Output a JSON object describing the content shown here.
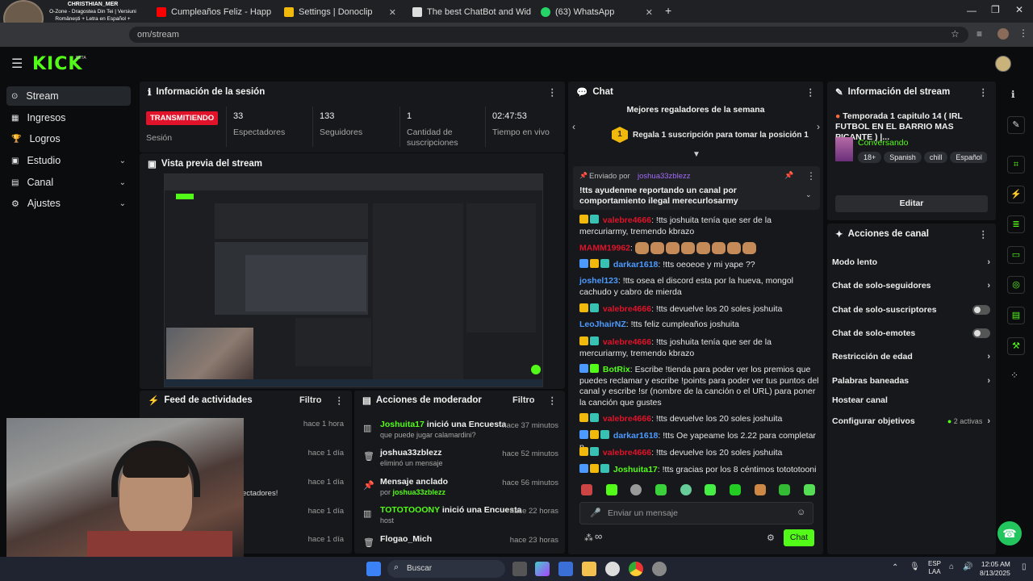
{
  "browser": {
    "tabs": [
      {
        "label": "CHRISTHIAN_MER",
        "sublabel": "O-Zone - Dragostea Din Tei | Versiuni Românești + Letra en Español + Video Oficial",
        "color": "#6b5b4b"
      },
      {
        "label": "Cumpleaños Feliz - Happy Birth",
        "color": "#ff0000"
      },
      {
        "label": "Settings | Donoclip",
        "color": "#f0b90b"
      },
      {
        "label": "The best ChatBot and Widg",
        "color": "#ffffff"
      },
      {
        "label": "(63) WhatsApp",
        "color": "#25d366"
      }
    ],
    "new_tab": "+",
    "url": "om/stream"
  },
  "kick": {
    "logo": "KICK",
    "beta": "BETA"
  },
  "sidebar": {
    "items": [
      {
        "label": "Stream",
        "icon": "stream-icon"
      },
      {
        "label": "Ingresos",
        "icon": "revenue-icon"
      },
      {
        "label": "Logros",
        "icon": "trophy-icon"
      },
      {
        "label": "Estudio",
        "icon": "studio-icon",
        "chevron": "⌄"
      },
      {
        "label": "Canal",
        "icon": "channel-icon",
        "chevron": "⌄"
      },
      {
        "label": "Ajustes",
        "icon": "gear-icon",
        "chevron": "⌄"
      }
    ]
  },
  "session": {
    "title": "Información de la sesión",
    "live_badge": "TRANSMITIENDO",
    "session_label": "Sesión",
    "stats": [
      {
        "value": "33",
        "label": "Espectadores"
      },
      {
        "value": "133",
        "label": "Seguidores"
      },
      {
        "value": "1",
        "label": "Cantidad de suscripciones"
      },
      {
        "value": "02:47:53",
        "label": "Tiempo en vivo"
      }
    ]
  },
  "preview": {
    "title": "Vista previa del stream"
  },
  "feed": {
    "title": "Feed de actividades",
    "filter": "Filtro",
    "rows": [
      {
        "time": "hace 1 hora"
      },
      {
        "time": "hace 1 día"
      },
      {
        "time": "hace 1 día",
        "text": "ectadores!"
      },
      {
        "time": "hace 1 día"
      },
      {
        "time": "hace 1 día"
      }
    ]
  },
  "mod": {
    "title": "Acciones de moderador",
    "filter": "Filtro",
    "rows": [
      {
        "user": "Joshuita17",
        "action": "inició una Encuesta",
        "sub": "que puede jugar calamardini?",
        "time": "hace 37 minutos",
        "icon": "poll-icon"
      },
      {
        "user": "joshua33zblezz",
        "action": "",
        "sub": "eliminó un mensaje",
        "time": "hace 52 minutos",
        "icon": "trash-icon"
      },
      {
        "user": "Mensaje anclado",
        "action": "",
        "sub": "por",
        "sub_user": "joshua33zblezz",
        "time": "hace 56 minutos",
        "icon": "pin-icon"
      },
      {
        "user": "TOTOTOOONY",
        "action": "inició una Encuesta",
        "sub": "host",
        "time": "hace 22 horas",
        "icon": "poll-icon"
      },
      {
        "user": "Flogao_Mich",
        "action": "",
        "sub": "",
        "time": "hace 23 horas",
        "icon": "trash-icon"
      }
    ]
  },
  "chat": {
    "title": "Chat",
    "gifters_title": "Mejores regaladores de la semana",
    "gifters_rank": "1",
    "gifters_text": "Regala 1 suscripción para tomar la posición 1",
    "pinned_prefix": "Enviado por",
    "pinned_user": "joshua33zblezz",
    "pinned_text": "!tts ayudenme reportando un canal por comportamiento ilegal merecurlosarmy",
    "messages": [
      {
        "user": "valebre4666",
        "color": "#e0132a",
        "text": "!tts joshuita tenía que ser de la mercuriarmy, tremendo kbrazo"
      },
      {
        "user": "MAMM19962",
        "color": "#e0132a",
        "text": "",
        "emotes": 8
      },
      {
        "user": "darkar1618",
        "color": "#4c9aff",
        "text": "!tts oeoeoe y mi yape ??"
      },
      {
        "user": "joshel123",
        "color": "#4c9aff",
        "text": "!tts osea el discord esta por la hueva, mongol cachudo y cabro de mierda"
      },
      {
        "user": "valebre4666",
        "color": "#e0132a",
        "text": "!tts devuelve los 20 soles joshuita"
      },
      {
        "user": "LeoJhairNZ",
        "color": "#4c9aff",
        "text": "!tts feliz cumpleaños joshuita"
      },
      {
        "user": "valebre4666",
        "color": "#e0132a",
        "text": "!tts joshuita tenía que ser de la mercuriarmy, tremendo kbrazo"
      },
      {
        "user": "BotRix",
        "color": "#53fc18",
        "text": "Escribe !tienda para poder ver los premios que puedes reclamar y escribe !points para poder ver tus puntos del canal y escribe !sr (nombre de la canción o el URL) para poner la canción que gustes"
      },
      {
        "user": "valebre4666",
        "color": "#e0132a",
        "text": "!tts devuelve los 20 soles joshuita"
      },
      {
        "user": "darkar1618",
        "color": "#4c9aff",
        "text": "!tts Oe yapeame los 2.22 para completar p"
      },
      {
        "user": "valebre4666",
        "color": "#e0132a",
        "text": "!tts devuelve los 20 soles joshuita"
      },
      {
        "user": "Joshuita17",
        "color": "#53fc18",
        "text": "!tts gracias por los 8 céntimos totototooni"
      }
    ],
    "input_placeholder": "Enviar un mensaje",
    "send_label": "Chat",
    "infinity": "∞"
  },
  "stream_info": {
    "title": "Información del stream",
    "stream_title": "Temporada 1 capitulo 14 ( IRL FUTBOL EN EL BARRIO MAS PICANTE ) |...",
    "category": "Conversando",
    "tags": [
      "18+",
      "Spanish",
      "chill",
      "Español"
    ],
    "edit_label": "Editar"
  },
  "channel_actions": {
    "title": "Acciones de canal",
    "items": [
      {
        "label": "Modo lento",
        "control": "arrow"
      },
      {
        "label": "Chat de solo-seguidores",
        "control": "arrow"
      },
      {
        "label": "Chat de solo-suscriptores",
        "control": "toggle"
      },
      {
        "label": "Chat de solo-emotes",
        "control": "toggle"
      },
      {
        "label": "Restricción de edad",
        "control": "arrow"
      },
      {
        "label": "Palabras baneadas",
        "control": "arrow"
      },
      {
        "label": "Hostear canal",
        "control": "none"
      },
      {
        "label": "Configurar objetivos",
        "control": "arrow",
        "extra": "2 activas"
      }
    ]
  },
  "taskbar": {
    "search": "Buscar",
    "lang": "ESP",
    "lang2": "LAA",
    "time": "12:05 AM",
    "date": "8/13/2025"
  },
  "colors": {
    "accent": "#53fc18",
    "live": "#e0132a",
    "panel": "#17181b",
    "bg": "#0b0c0e"
  }
}
